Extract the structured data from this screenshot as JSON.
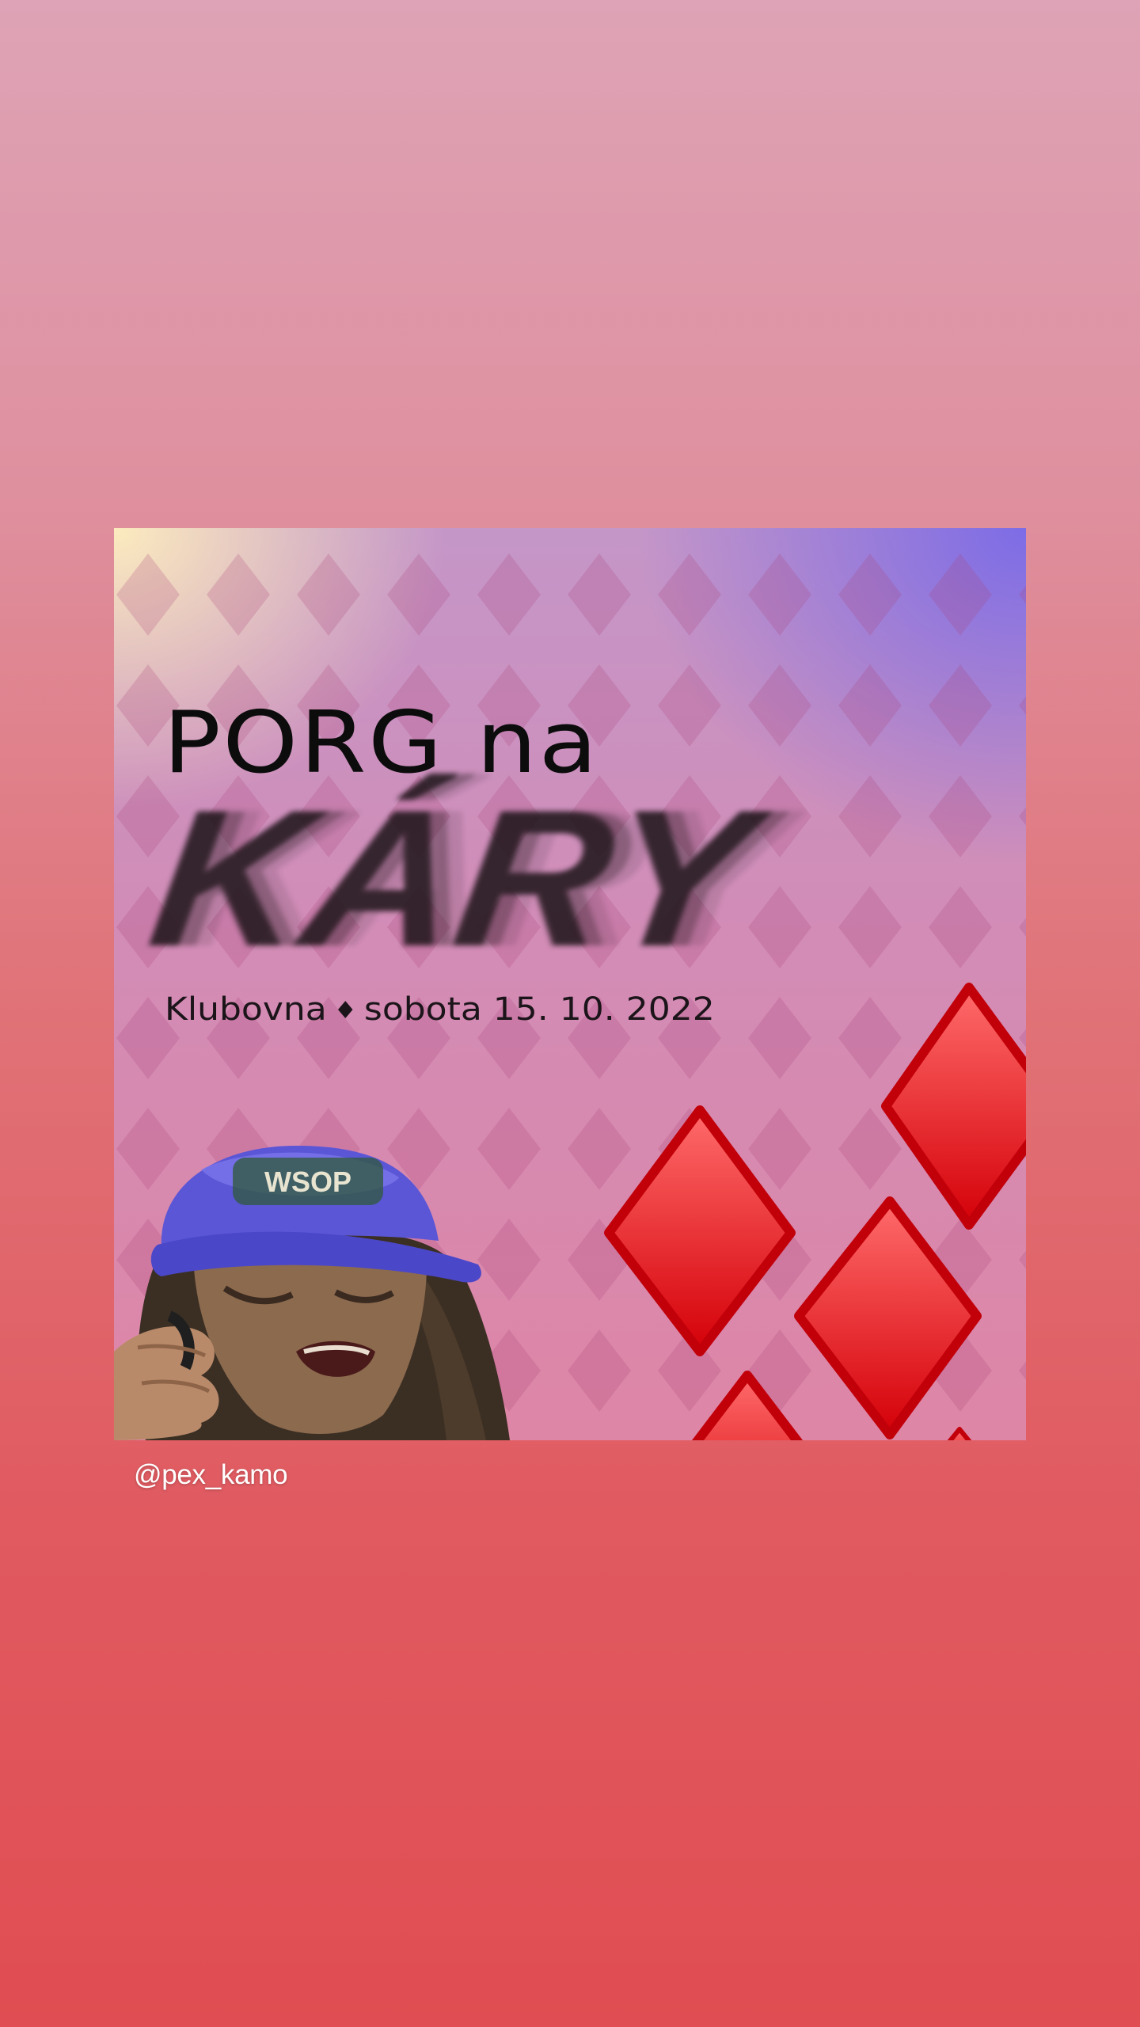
{
  "post": {
    "title": "PORG na",
    "headline": "KÁRY",
    "venue": "Klubovna",
    "separator": "♦",
    "date_text": "sobota 15. 10. 2022",
    "cap_text": "WSOP"
  },
  "author": {
    "username": "@pex_kamo"
  },
  "colors": {
    "background_top": "#dea3b6",
    "background_bottom": "#e04d52",
    "diamond_red": "#e5111a",
    "cap_blue": "#5a56d6"
  }
}
